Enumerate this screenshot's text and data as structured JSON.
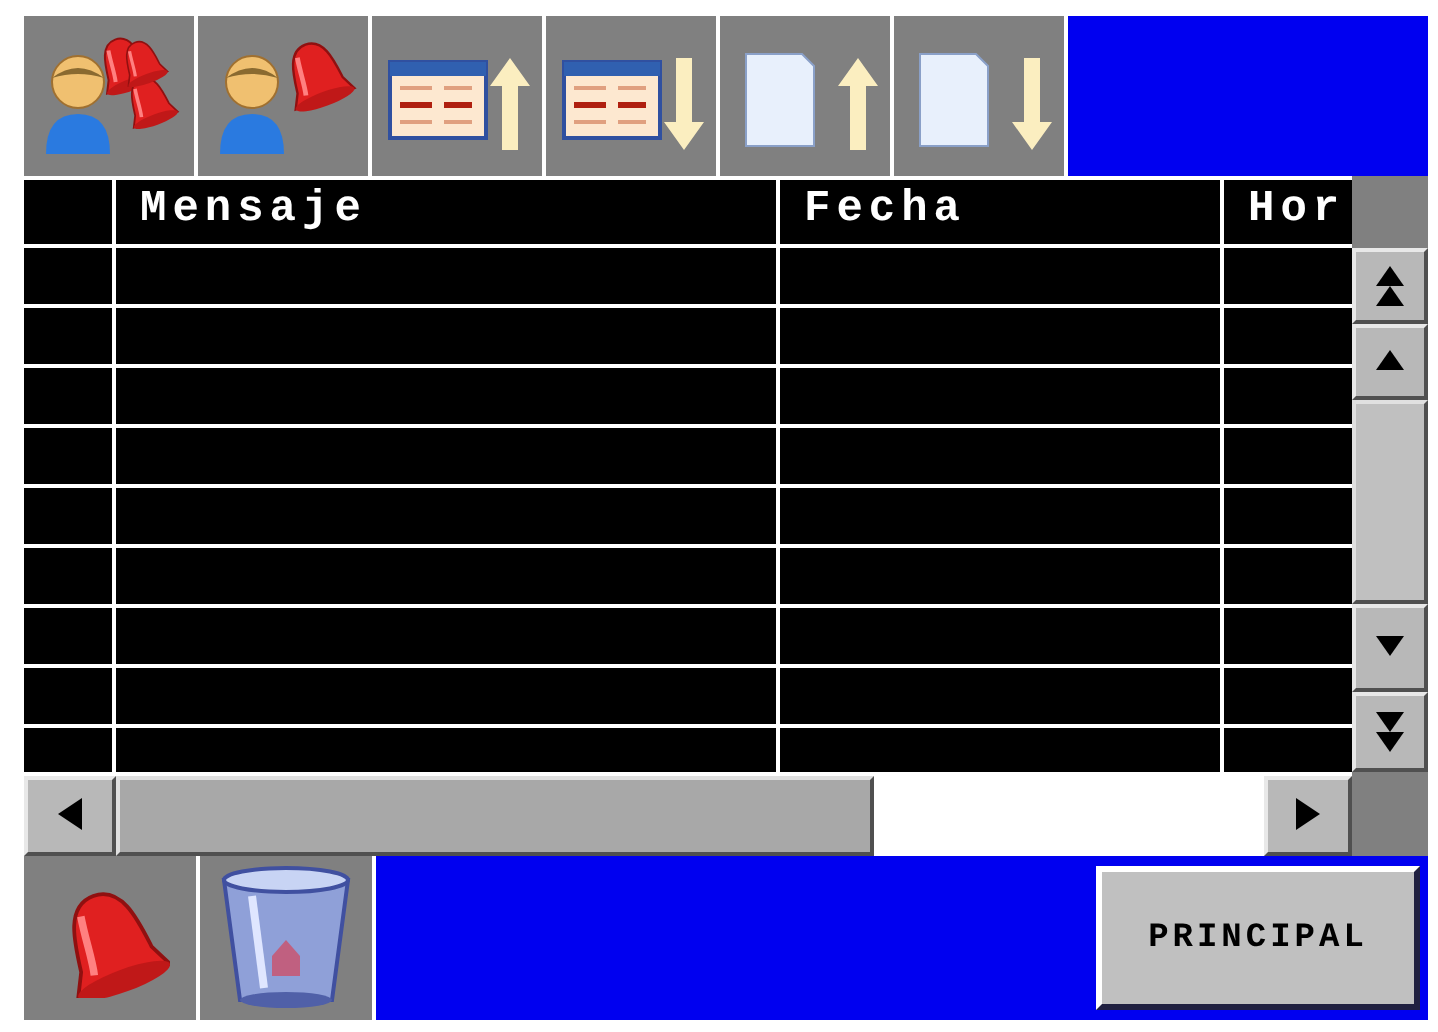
{
  "toolbar": {
    "buttons": [
      {
        "kind": "person-bells"
      },
      {
        "kind": "person-bell"
      },
      {
        "kind": "table-up"
      },
      {
        "kind": "table-down"
      },
      {
        "kind": "document-up"
      },
      {
        "kind": "document-down"
      }
    ]
  },
  "table": {
    "columns": [
      "Mensaje",
      "Fecha",
      "Hor"
    ]
  },
  "bottom_bar": {
    "buttons": [
      {
        "kind": "bell"
      },
      {
        "kind": "trash"
      }
    ],
    "principal_button": "PRINCIPAL"
  }
}
